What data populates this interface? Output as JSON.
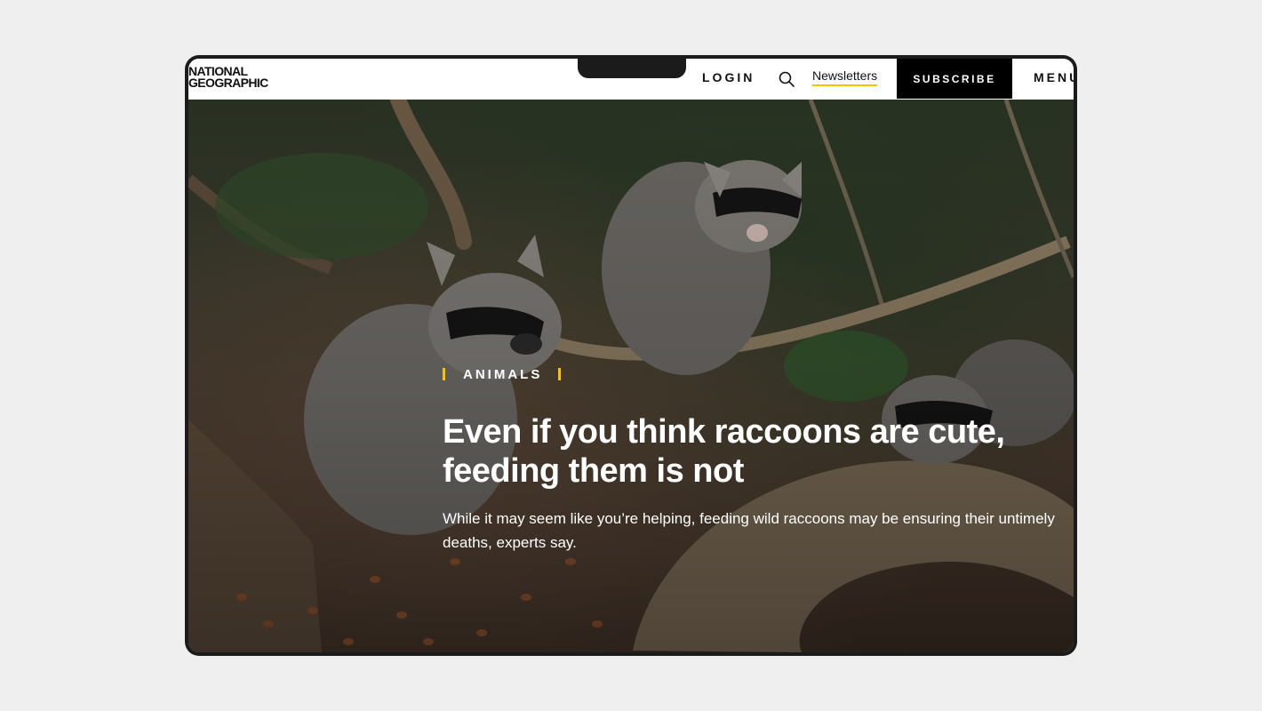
{
  "nav": {
    "logo_line1": "NATIONAL",
    "logo_line2": "GEOGRAPHIC",
    "login_label": "LOGIN",
    "search_icon": "search-icon",
    "newsletters_label": "Newsletters",
    "subscribe_label": "SUBSCRIBE",
    "menu_label": "MENU"
  },
  "hero": {
    "category": "ANIMALS",
    "headline": "Even if you think raccoons are cute, feeding them is not",
    "dek": "While it may seem like you’re helping, feeding wild raccoons may be ensuring their untimely deaths, experts say."
  },
  "colors": {
    "accent": "#f5c400",
    "subscribe_bg": "#000000",
    "device_frame": "#1b1b1b",
    "page_bg": "#efefef"
  }
}
